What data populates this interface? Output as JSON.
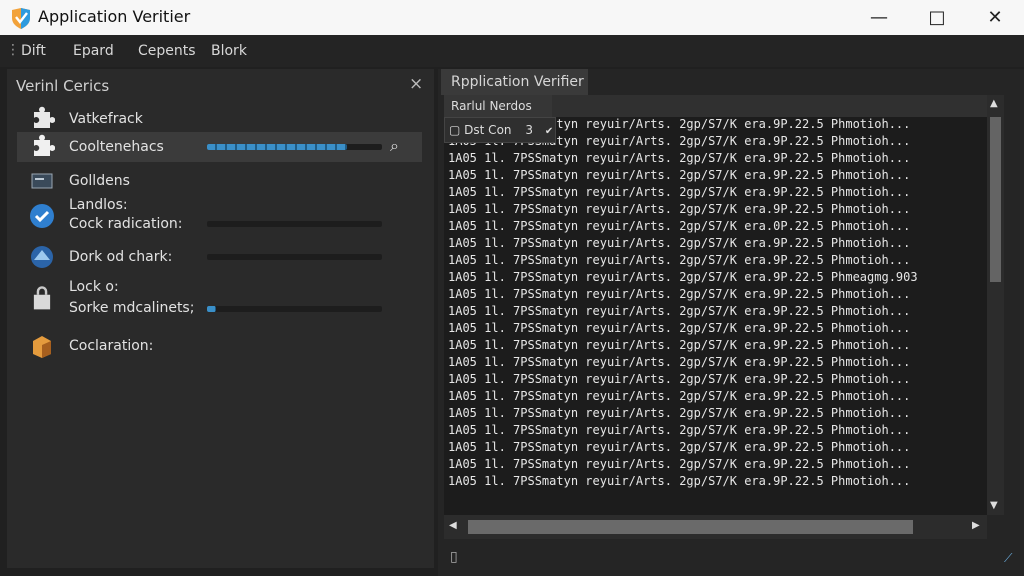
{
  "window": {
    "title": "Application Veritier",
    "minimize_symbol": "—",
    "maximize_symbol": "□",
    "close_symbol": "✕",
    "app_icon_name": "app-shield-icon",
    "accent": "#2f9bde"
  },
  "menu": [
    "Dift",
    "Epard",
    "Cepents",
    "Blork"
  ],
  "left_panel": {
    "title": "Verinl Cerics",
    "close_symbol": "×",
    "items": [
      {
        "label": "Vatkefrack",
        "icon": "puzzle-icon",
        "progress": null
      },
      {
        "label": "Cooltenehacs",
        "icon": "puzzle-icon",
        "progress": 0.8,
        "selected": true
      },
      {
        "label": "Golldens",
        "icon": "monitor-icon",
        "progress": null
      },
      {
        "label": "Landlos:",
        "sublabel": "Cock radication:",
        "icon": "checkmark-icon",
        "progress": 0
      },
      {
        "label": "Dork od chark:",
        "icon": "network-icon",
        "progress": 0
      },
      {
        "label": "Lock o:",
        "sublabel": "Sorke mdcalinets;",
        "icon": "lock-icon",
        "progress": 0.05
      },
      {
        "label": "Coclaration:",
        "icon": "box-icon",
        "progress": null
      }
    ]
  },
  "right_panel": {
    "tab": "Rpplication Verifier",
    "subtab": "Rarlul Nerdos",
    "dropdown": "Dst Con",
    "dropdown_value": "3",
    "log_rows": [
      "1A05 1l. 7PSSmatyn reyuir/Arts. 2gp/S7/K era.9P.22.5 Phmotioh...",
      "1A05 1l. 7PSSmatyn reyuir/Arts. 2gp/S7/K era.9P.22.5 Phmotioh...",
      "1A05 1l. 7PSSmatyn reyuir/Arts. 2gp/S7/K era.9P.22.5 Phmotioh...",
      "1A05 1l. 7PSSmatyn reyuir/Arts. 2gp/S7/K era.9P.22.5 Phmotioh...",
      "1A05 1l. 7PSSmatyn reyuir/Arts. 2gp/S7/K era.9P.22.5 Phmotioh...",
      "1A05 1l. 7PSSmatyn reyuir/Arts. 2gp/S7/K era.9P.22.5 Phmotioh...",
      "1A05 1l. 7PSSmatyn reyuir/Arts. 2gp/S7/K era.0P.22.5 Phmotioh...",
      "1A05 1l. 7PSSmatyn reyuir/Arts. 2gp/S7/K era.9P.22.5 Phmotioh...",
      "1A05 1l. 7PSSmatyn reyuir/Arts. 2gp/S7/K era.9P.22.5 Phmotioh...",
      "1A05 1l. 7PSSmatyn reyuir/Arts. 2gp/S7/K era.9P.22.5 Phmeagmg.903",
      "1A05 1l. 7PSSmatyn reyuir/Arts. 2gp/S7/K era.9P.22.5 Phmotioh...",
      "1A05 1l. 7PSSmatyn reyuir/Arts. 2gp/S7/K era.9P.22.5 Phmotioh...",
      "1A05 1l. 7PSSmatyn reyuir/Arts. 2gp/S7/K era.9P.22.5 Phmotioh...",
      "1A05 1l. 7PSSmatyn reyuir/Arts. 2gp/S7/K era.9P.22.5 Phmotioh...",
      "1A05 1l. 7PSSmatyn reyuir/Arts. 2gp/S7/K era.9P.22.5 Phmotioh...",
      "1A05 1l. 7PSSmatyn reyuir/Arts. 2gp/S7/K era.9P.22.5 Phmotioh...",
      "1A05 1l. 7PSSmatyn reyuir/Arts. 2gp/S7/K era.9P.22.5 Phmotioh...",
      "1A05 1l. 7PSSmatyn reyuir/Arts. 2gp/S7/K era.9P.22.5 Phmotioh...",
      "1A05 1l. 7PSSmatyn reyuir/Arts. 2gp/S7/K era.9P.22.5 Phmotioh...",
      "1A05 1l. 7PSSmatyn reyuir/Arts. 2gp/S7/K era.9P.22.5 Phmotioh...",
      "1A05 1l. 7PSSmatyn reyuir/Arts. 2gp/S7/K era.9P.22.5 Phmotioh...",
      "1A05 1l. 7PSSmatyn reyuir/Arts. 2gp/S7/K era.9P.22.5 Phmotioh..."
    ]
  },
  "status": {
    "left_icon": "panel-icon",
    "resize_icon": "resize-grip-icon"
  }
}
